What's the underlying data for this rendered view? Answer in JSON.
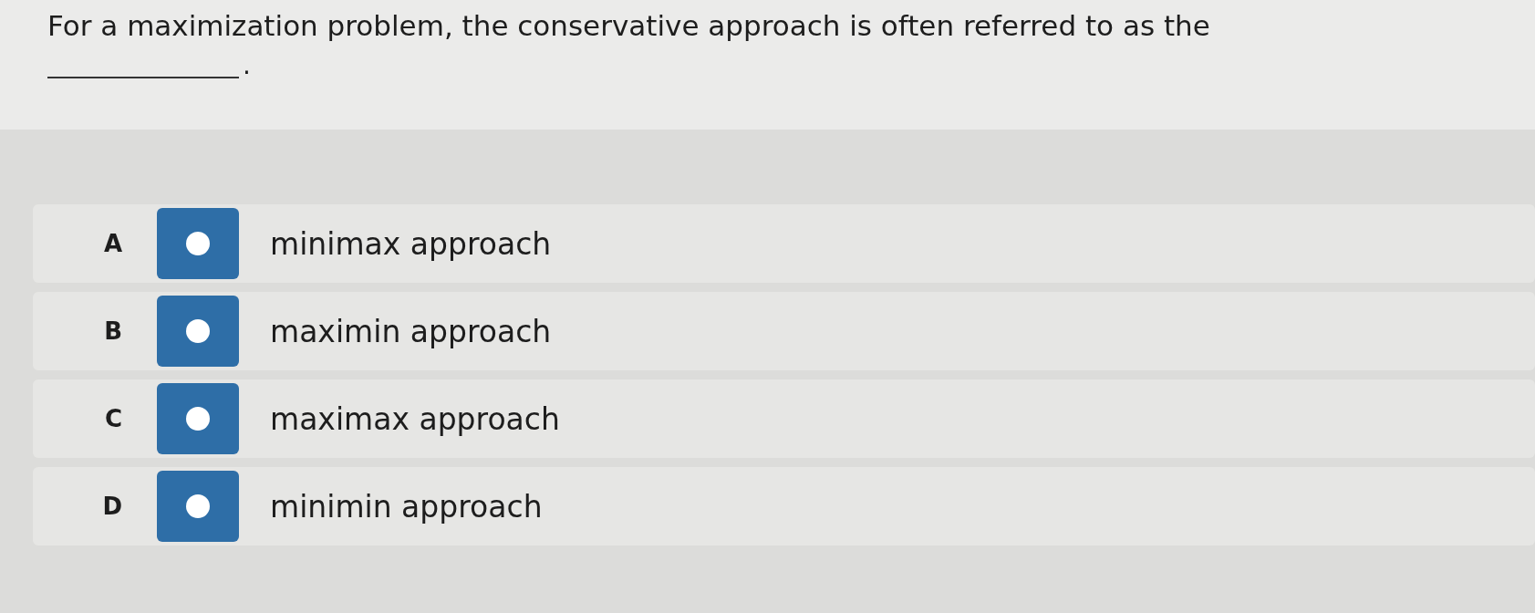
{
  "question": {
    "text": "For a maximization problem, the conservative approach is often referred to as the",
    "blank_end": "."
  },
  "options": [
    {
      "letter": "A",
      "label": "minimax approach",
      "selected": false
    },
    {
      "letter": "B",
      "label": "maximin approach",
      "selected": false
    },
    {
      "letter": "C",
      "label": "maximax approach",
      "selected": false
    },
    {
      "letter": "D",
      "label": "minimin approach",
      "selected": false
    }
  ]
}
